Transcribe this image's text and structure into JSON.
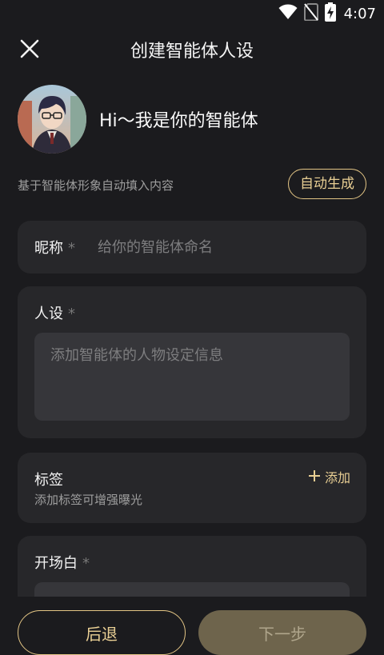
{
  "status_bar": {
    "time": "4:07",
    "icons": [
      "wifi-icon",
      "no-sim-icon",
      "battery-charging-icon"
    ]
  },
  "header": {
    "title": "创建智能体人设",
    "close_icon": "close-icon"
  },
  "profile": {
    "greeting": "Hi～我是你的智能体"
  },
  "auto_fill": {
    "hint": "基于智能体形象自动填入内容",
    "button_label": "自动生成"
  },
  "form": {
    "nickname": {
      "label": "昵称",
      "required_mark": "*",
      "placeholder": "给你的智能体命名",
      "value": ""
    },
    "persona": {
      "label": "人设",
      "required_mark": "*",
      "placeholder": "添加智能体的人物设定信息",
      "value": ""
    },
    "tags": {
      "label": "标签",
      "hint": "添加标签可增强曝光",
      "add_label": "添加",
      "add_icon": "plus-icon"
    },
    "opening": {
      "label": "开场白",
      "required_mark": "*"
    }
  },
  "footer": {
    "back_label": "后退",
    "next_label": "下一步"
  },
  "colors": {
    "background": "#1b1b1e",
    "card": "#27272a",
    "input": "#36363a",
    "accent_gold": "#e3c585",
    "next_button_disabled": "#6e644c"
  }
}
